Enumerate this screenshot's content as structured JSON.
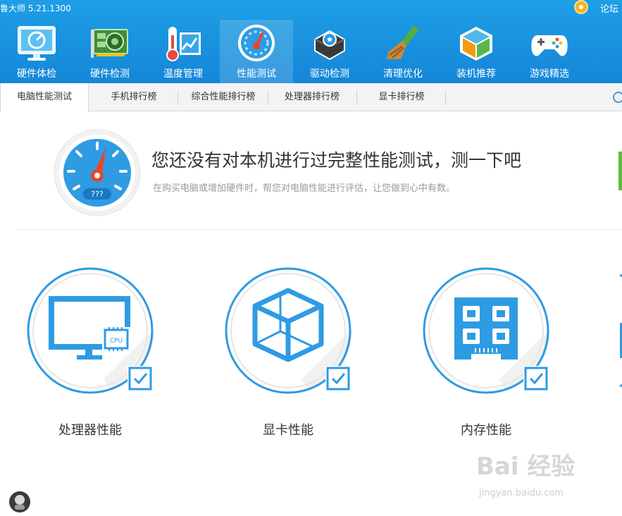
{
  "app": {
    "title": "鲁大师 5.21.1300",
    "forum_label": "论坛"
  },
  "nav": [
    {
      "label": "硬件体检",
      "icon": "monitor-check-icon"
    },
    {
      "label": "硬件检测",
      "icon": "hardware-card-icon"
    },
    {
      "label": "温度管理",
      "icon": "thermometer-icon"
    },
    {
      "label": "性能测试",
      "icon": "speedometer-icon",
      "active": true
    },
    {
      "label": "驱动检测",
      "icon": "driver-gear-icon"
    },
    {
      "label": "清理优化",
      "icon": "broom-icon"
    },
    {
      "label": "装机推荐",
      "icon": "cube-icon"
    },
    {
      "label": "游戏精选",
      "icon": "gamepad-icon"
    }
  ],
  "tabs": [
    {
      "label": "电脑性能测试",
      "active": true
    },
    {
      "label": "手机排行榜"
    },
    {
      "label": "综合性能排行榜"
    },
    {
      "label": "处理器排行榜"
    },
    {
      "label": "显卡排行榜"
    }
  ],
  "hero": {
    "gauge_text": "???",
    "title": "您还没有对本机进行过完整性能测试，测一下吧",
    "subtitle": "在购买电脑或增加硬件时，帮您对电脑性能进行评估，让您做到心中有数。"
  },
  "cards": [
    {
      "label": "处理器性能",
      "icon": "cpu-monitor-icon",
      "checked": true,
      "chip_text": "CPU"
    },
    {
      "label": "显卡性能",
      "icon": "gpu-cube-icon",
      "checked": true
    },
    {
      "label": "内存性能",
      "icon": "memory-chip-icon",
      "checked": true
    }
  ],
  "watermark": {
    "brand": "Bai 经验",
    "site": "jingyan.baidu.com"
  },
  "colors": {
    "brand_blue": "#1586d8",
    "icon_blue": "#2e9be3",
    "accent_green": "#5bbf3a"
  }
}
